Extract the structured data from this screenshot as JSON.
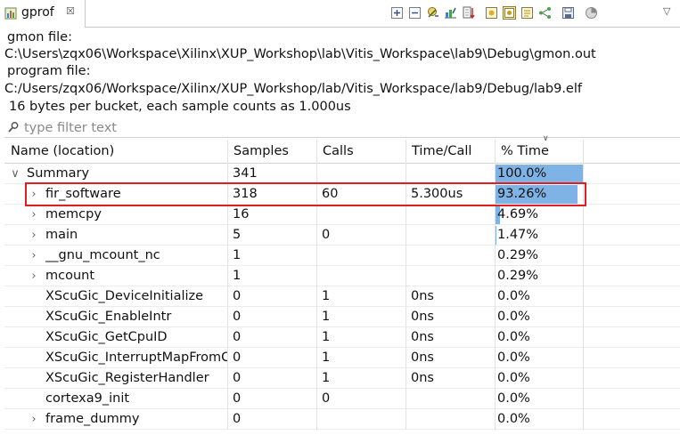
{
  "tab": {
    "title": "gprof",
    "close_glyph": "☒",
    "icon": "gprof-view-icon"
  },
  "toolbar": {
    "buttons": [
      "expand-all-icon",
      "collapse-all-icon",
      "sort-icon",
      "export-csv-icon",
      "export-text-icon",
      "flat-profile-icon",
      "function-view-icon",
      "file-view-icon",
      "call-graph-icon",
      "save-icon",
      "pie-chart-icon"
    ],
    "menu_glyph": "▽"
  },
  "info": {
    "gmon_label": "gmon file:",
    "gmon_path": "C:\\Users\\zqx06\\Workspace\\Xilinx\\XUP_Workshop\\lab\\Vitis_Workspace\\lab9\\Debug\\gmon.out",
    "program_label": "program file:",
    "program_path": "C:/Users/zqx06/Workspace/Xilinx/XUP_Workshop/lab/Vitis_Workspace/lab9/Debug/lab9.elf",
    "bucket_info": "16 bytes per bucket, each sample counts as 1.000us"
  },
  "filter": {
    "placeholder": "type filter text"
  },
  "table": {
    "columns": [
      "Name (location)",
      "Samples",
      "Calls",
      "Time/Call",
      "% Time"
    ],
    "rows": [
      {
        "name": "Summary",
        "samples": "341",
        "calls": "",
        "timecall": "",
        "pct": "100.0%",
        "pct_value": 100.0,
        "expander": "∨",
        "indent": 0
      },
      {
        "name": "fir_software",
        "samples": "318",
        "calls": "60",
        "timecall": "5.300us",
        "pct": "93.26%",
        "pct_value": 93.26,
        "expander": "›",
        "indent": 1
      },
      {
        "name": "memcpy",
        "samples": "16",
        "calls": "",
        "timecall": "",
        "pct": "4.69%",
        "pct_value": 4.69,
        "expander": "›",
        "indent": 1
      },
      {
        "name": "main",
        "samples": "5",
        "calls": "0",
        "timecall": "",
        "pct": "1.47%",
        "pct_value": 1.47,
        "expander": "›",
        "indent": 1
      },
      {
        "name": "__gnu_mcount_nc",
        "samples": "1",
        "calls": "",
        "timecall": "",
        "pct": "0.29%",
        "pct_value": 0.29,
        "expander": "›",
        "indent": 1
      },
      {
        "name": "mcount",
        "samples": "1",
        "calls": "",
        "timecall": "",
        "pct": "0.29%",
        "pct_value": 0.29,
        "expander": "›",
        "indent": 1
      },
      {
        "name": "XScuGic_DeviceInitialize",
        "samples": "0",
        "calls": "1",
        "timecall": "0ns",
        "pct": "0.0%",
        "pct_value": 0.0,
        "expander": "",
        "indent": 1
      },
      {
        "name": "XScuGic_EnableIntr",
        "samples": "0",
        "calls": "1",
        "timecall": "0ns",
        "pct": "0.0%",
        "pct_value": 0.0,
        "expander": "",
        "indent": 1
      },
      {
        "name": "XScuGic_GetCpuID",
        "samples": "0",
        "calls": "1",
        "timecall": "0ns",
        "pct": "0.0%",
        "pct_value": 0.0,
        "expander": "",
        "indent": 1
      },
      {
        "name": "XScuGic_InterruptMapFromCpuID",
        "samples": "0",
        "calls": "1",
        "timecall": "0ns",
        "pct": "0.0%",
        "pct_value": 0.0,
        "expander": "",
        "indent": 1
      },
      {
        "name": "XScuGic_RegisterHandler",
        "samples": "0",
        "calls": "1",
        "timecall": "0ns",
        "pct": "0.0%",
        "pct_value": 0.0,
        "expander": "",
        "indent": 1
      },
      {
        "name": "cortexa9_init",
        "samples": "0",
        "calls": "0",
        "timecall": "",
        "pct": "0.0%",
        "pct_value": 0.0,
        "expander": "",
        "indent": 1
      },
      {
        "name": "frame_dummy",
        "samples": "0",
        "calls": "",
        "timecall": "",
        "pct": "0.0%",
        "pct_value": 0.0,
        "expander": "›",
        "indent": 1
      }
    ]
  },
  "colors": {
    "bar": "#7fb2e5",
    "highlight": "#e02020"
  }
}
